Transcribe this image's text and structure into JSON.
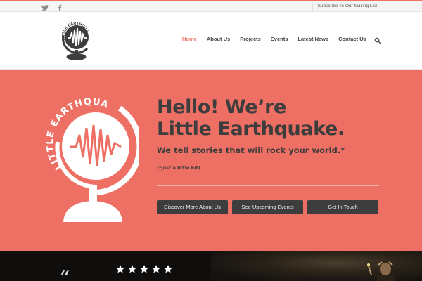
{
  "topbar": {
    "social": [
      "twitter-icon",
      "facebook-icon"
    ],
    "mailing_label": "Subscribe To Our Mailing List"
  },
  "header": {
    "logo_text": "LITTLE EARTHQUAKE",
    "nav": [
      {
        "label": "Home",
        "active": true
      },
      {
        "label": "About Us",
        "active": false
      },
      {
        "label": "Projects",
        "active": false
      },
      {
        "label": "Events",
        "active": false
      },
      {
        "label": "Latest News",
        "active": false
      },
      {
        "label": "Contact Us",
        "active": false
      }
    ],
    "search_icon": "search-icon"
  },
  "hero": {
    "logo_text": "LITTLE EARTHQUAKE",
    "title_line1": "Hello! We’re",
    "title_line2": "Little Earthquake.",
    "tagline": "We tell stories that will rock your world.*",
    "footnote": "(*just a little bit)",
    "buttons": [
      "Discover More About Us",
      "See Upcoming Events",
      "Get In Touch"
    ],
    "background_color": "#ee6f63"
  },
  "review": {
    "stars": 5,
    "quote_mark": "“"
  },
  "colors": {
    "accent": "#ef6f63",
    "dark": "#3d3d3d"
  }
}
